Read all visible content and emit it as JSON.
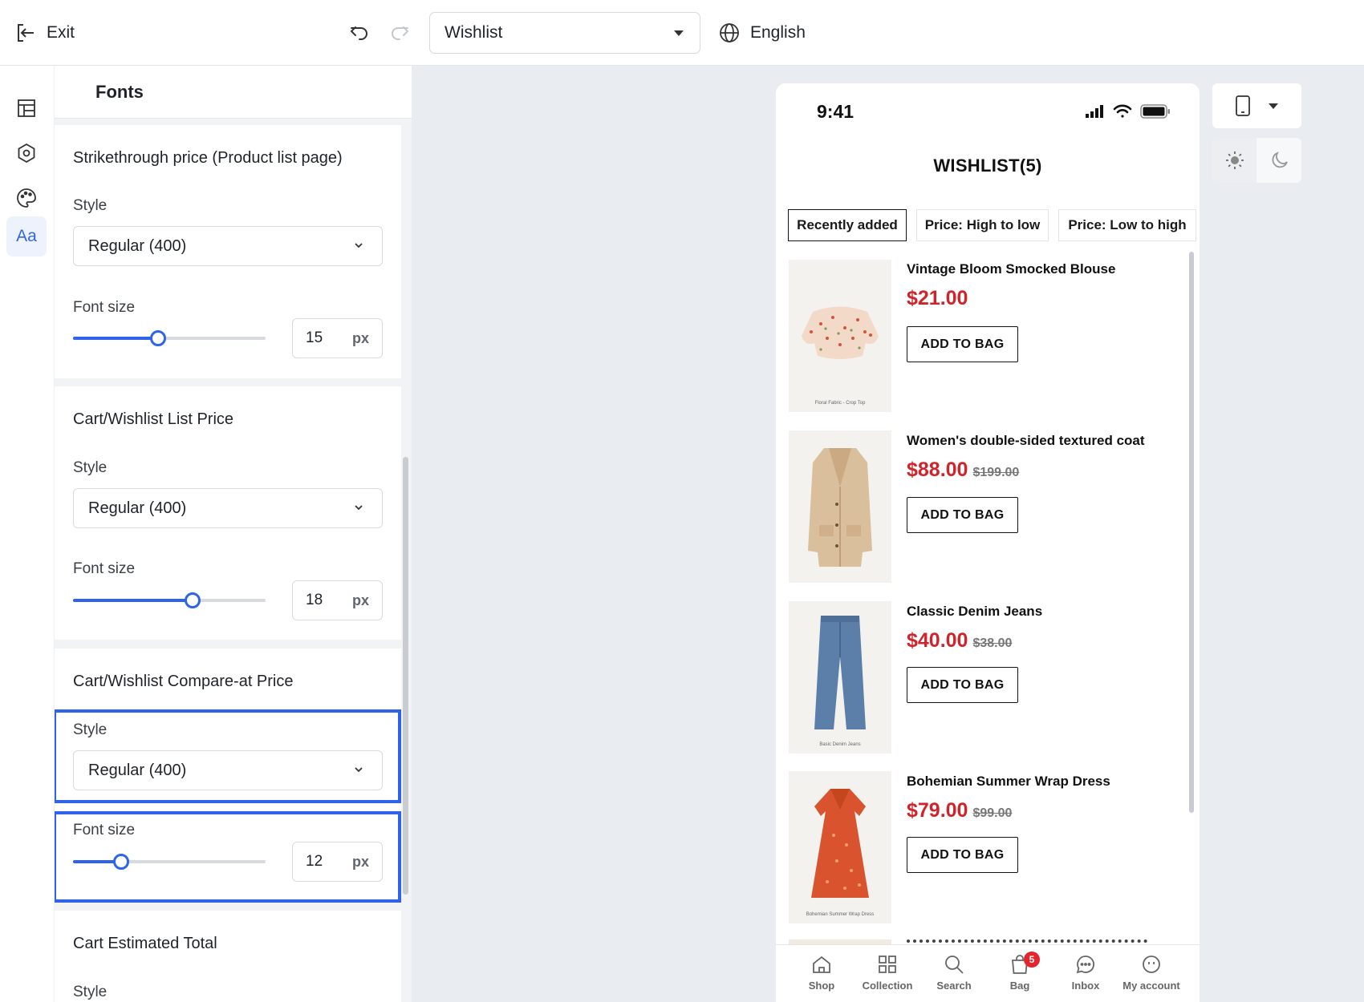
{
  "topbar": {
    "exit_label": "Exit",
    "page_select_value": "Wishlist",
    "language": "English"
  },
  "rail": {
    "items": [
      "layout-icon",
      "hexagon-icon",
      "palette-icon",
      "typography-icon"
    ],
    "typography_label": "Aa",
    "active": "typography"
  },
  "panel": {
    "title": "Fonts",
    "sections": [
      {
        "title": "Strikethrough price (Product list page)",
        "style_label": "Style",
        "style_value": "Regular (400)",
        "size_label": "Font size",
        "size_value": "15",
        "size_unit": "px",
        "slider_fraction": 0.44
      },
      {
        "title": "Cart/Wishlist List Price",
        "style_label": "Style",
        "style_value": "Regular (400)",
        "size_label": "Font size",
        "size_value": "18",
        "size_unit": "px",
        "slider_fraction": 0.62
      },
      {
        "title": "Cart/Wishlist Compare-at Price",
        "style_label": "Style",
        "style_value": "Regular (400)",
        "size_label": "Font size",
        "size_value": "12",
        "size_unit": "px",
        "slider_fraction": 0.25
      },
      {
        "title": "Cart Estimated Total",
        "style_label": "Style"
      }
    ],
    "highlight_color": "#2f63ea"
  },
  "phone": {
    "time": "9:41",
    "title": "WISHLIST(5)",
    "sort_tabs": [
      "Recently added",
      "Price: High to low",
      "Price: Low to high"
    ],
    "active_sort": "Recently added",
    "items": [
      {
        "name": "Vintage Bloom Smocked Blouse",
        "price": "$21.00",
        "compare": "",
        "button": "ADD TO BAG",
        "image_caption": "Floral Fabric - Crop Top"
      },
      {
        "name": "Women's double-sided textured coat",
        "price": "$88.00",
        "compare": "$199.00",
        "button": "ADD TO BAG",
        "image_caption": ""
      },
      {
        "name": "Classic Denim Jeans",
        "price": "$40.00",
        "compare": "$38.00",
        "button": "ADD TO BAG",
        "image_caption": "Basic Denim Jeans"
      },
      {
        "name": "Bohemian Summer Wrap Dress",
        "price": "$79.00",
        "compare": "$99.00",
        "button": "ADD TO BAG",
        "image_caption": "Bohemian Summer Wrap Dress"
      }
    ],
    "tabbar": [
      {
        "label": "Shop",
        "icon": "home-icon"
      },
      {
        "label": "Collection",
        "icon": "grid-icon"
      },
      {
        "label": "Search",
        "icon": "search-icon"
      },
      {
        "label": "Bag",
        "icon": "bag-icon",
        "badge": "5"
      },
      {
        "label": "Inbox",
        "icon": "chat-icon"
      },
      {
        "label": "My account",
        "icon": "account-icon"
      }
    ],
    "price_color": "#d1232a"
  },
  "tools": {
    "device": "mobile-icon",
    "themes": [
      "sun-icon",
      "moon-icon"
    ],
    "active_theme": "light"
  }
}
